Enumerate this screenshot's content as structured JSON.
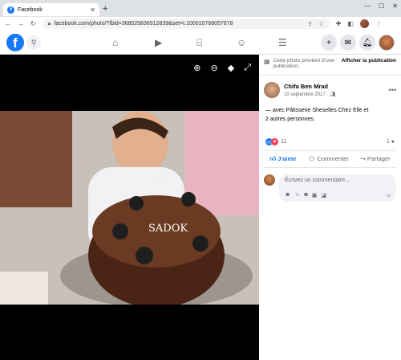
{
  "browser": {
    "tab_title": "Facebook",
    "tab_close": "✕",
    "new_tab": "+",
    "url": "facebook.com/photo/?fbid=368525836912839&set=t.100010768057678"
  },
  "fbbar": {
    "logo": "f"
  },
  "photo_panel": {
    "notice_text": "Cette photo provient d’une publication.",
    "notice_button": "Afficher la publication"
  },
  "post": {
    "author": "Chifa Ben Mrad",
    "date": "10 septembre 2017 · ",
    "text_line1": "— avec Pâtisserie Sheselles Chez Elle et",
    "text_line2": "2 autres personnes.",
    "reaction_count": "11",
    "comment_count": "1",
    "like_label": "J'aime",
    "comment_label": "Commenter",
    "share_label": "Partager",
    "comment_placeholder": "Écrivez un commentaire..."
  },
  "colors": {
    "brand": "#1877f2",
    "love": "#f33e58",
    "chrome_bg": "#dee1e6"
  }
}
